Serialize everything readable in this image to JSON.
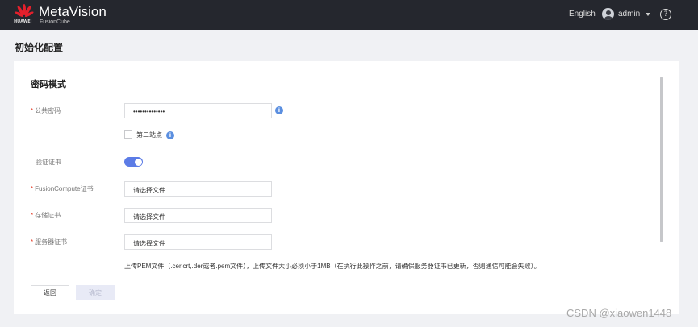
{
  "header": {
    "brand": "MetaVision",
    "subtitle": "FusionCube",
    "vendor": "HUAWEI",
    "language": "English",
    "user": "admin",
    "help_icon": "?"
  },
  "page": {
    "title": "初始化配置"
  },
  "form": {
    "section_title": "密码模式",
    "public_password": {
      "label": "公共密码",
      "value": "••••••••••••••"
    },
    "second_site": {
      "label": "第二站点",
      "checked": false
    },
    "verify_cert": {
      "label": "验证证书",
      "enabled": true
    },
    "fc_cert": {
      "label": "FusionCompute证书",
      "placeholder": "请选择文件"
    },
    "storage_cert": {
      "label": "存储证书",
      "placeholder": "请选择文件"
    },
    "server_cert": {
      "label": "服务器证书",
      "placeholder": "请选择文件"
    },
    "hint": "上传PEM文件（.cer,crt,.der或者.pem文件），上传文件大小必须小于1MB（在执行此操作之前，请确保服务器证书已更新，否则通信可能会失败）。",
    "required_mark": "*"
  },
  "buttons": {
    "back": "返回",
    "confirm": "确定"
  },
  "watermark": "CSDN @xiaowen1448",
  "colors": {
    "header": "#25272e",
    "accent": "#5c7ce6",
    "required": "#e5412d"
  }
}
